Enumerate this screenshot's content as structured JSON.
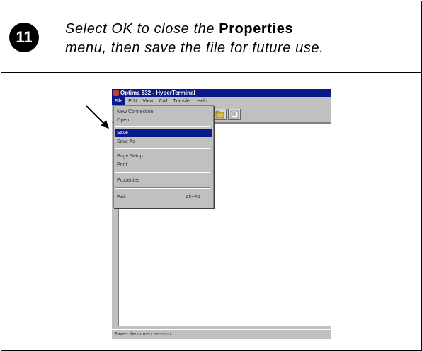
{
  "step": {
    "number": "11"
  },
  "instruction": {
    "part1": "Select OK to close the ",
    "bold": "Properties",
    "part2": "menu, then save the file for future use."
  },
  "window": {
    "title": "Optima 832 - HyperTerminal",
    "menus": [
      "File",
      "Edit",
      "View",
      "Call",
      "Transfer",
      "Help"
    ],
    "status_text": "Saves the current session"
  },
  "file_menu": {
    "items": [
      {
        "label": "New Connection",
        "highlighted": false
      },
      {
        "label": "Open",
        "highlighted": false
      },
      {
        "label": "Save",
        "highlighted": true
      },
      {
        "label": "Save As",
        "highlighted": false
      },
      {
        "label": "Page Setup",
        "highlighted": false
      },
      {
        "label": "Print",
        "highlighted": false
      },
      {
        "label": "Properties",
        "highlighted": false
      },
      {
        "label": "Exit",
        "accelerator": "Alt+F4",
        "highlighted": false
      }
    ]
  },
  "colors": {
    "titlebar": "#0a1a8a",
    "highlight": "#0a1a8a",
    "step_badge": "#000000"
  },
  "icons": [
    "arrow-pointer-icon",
    "open-folder-icon",
    "properties-icon",
    "app-icon"
  ]
}
